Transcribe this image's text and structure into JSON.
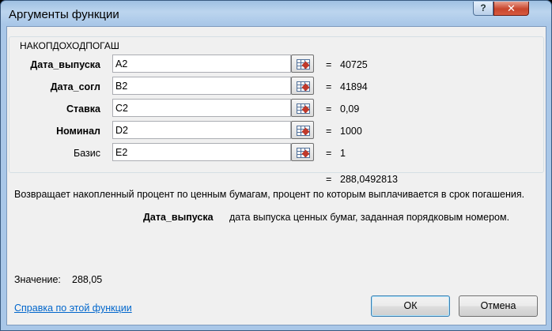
{
  "window": {
    "title": "Аргументы функции",
    "help_glyph": "?",
    "close_glyph": "✕"
  },
  "function_name": "НАКОПДОХОДПОГАШ",
  "arguments": [
    {
      "label": "Дата_выпуска",
      "input": "A2",
      "value": "40725",
      "bold": true
    },
    {
      "label": "Дата_согл",
      "input": "B2",
      "value": "41894",
      "bold": true
    },
    {
      "label": "Ставка",
      "input": "C2",
      "value": "0,09",
      "bold": true
    },
    {
      "label": "Номинал",
      "input": "D2",
      "value": "1000",
      "bold": true
    },
    {
      "label": "Базис",
      "input": "E2",
      "value": "1",
      "bold": false
    }
  ],
  "equals": "=",
  "result": "288,0492813",
  "description": "Возвращает накопленный процент по ценным бумагам, процент по которым выплачивается в срок погашения.",
  "arg_description": {
    "name": "Дата_выпуска",
    "text": "дата выпуска ценных бумаг, заданная порядковым номером."
  },
  "value": {
    "label": "Значение:",
    "number": "288,05"
  },
  "help_link": "Справка по этой функции",
  "buttons": {
    "ok": "ОК",
    "cancel": "Отмена"
  }
}
